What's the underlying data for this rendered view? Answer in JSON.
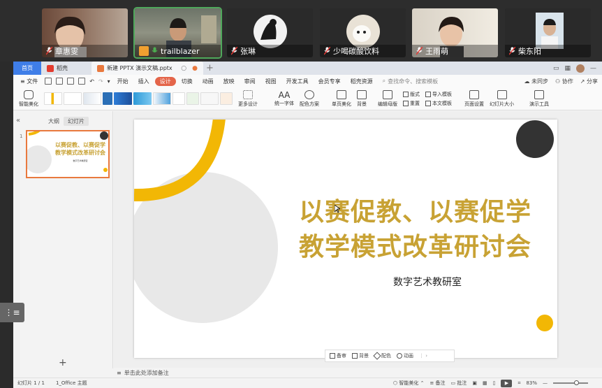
{
  "participants": [
    {
      "name": "章惠雯"
    },
    {
      "name": "trailblazer"
    },
    {
      "name": "张琳"
    },
    {
      "name": "少喝碳酸饮料"
    },
    {
      "name": "王雨萌"
    },
    {
      "name": "柴东阳"
    }
  ],
  "tabs": {
    "home": "首页",
    "wps": "稻壳",
    "file": "新建 PPTX 演示文稿.pptx"
  },
  "menu": {
    "file": "文件",
    "items": [
      "开始",
      "插入",
      "设计",
      "切换",
      "动画",
      "放映",
      "审阅",
      "视图",
      "开发工具",
      "会员专享",
      "稻壳资源"
    ],
    "active_index": 2,
    "search": "查找命令、搜索模板",
    "sync": "未同步",
    "collab": "协作",
    "share": "分享"
  },
  "ribbon": {
    "smart_beautify": "智能美化",
    "more_design": "更多设计",
    "unify_font": "统一字体",
    "color_scheme": "配色方案",
    "single_beautify": "单页美化",
    "background": "背景",
    "edit_master": "编辑母版",
    "format": "版式",
    "reset": "重置",
    "import_template": "导入模板",
    "text_template": "本文模板",
    "page_setup": "页面设置",
    "slide_size": "幻灯片大小",
    "presenter_tools": "演示工具"
  },
  "left_panel": {
    "outline_tab": "大纲",
    "slides_tab": "幻灯片",
    "slide_number": "1",
    "thumb_title": "以赛促教、以赛促学\n教学模式改革研讨会",
    "thumb_subtitle": "数字艺术教研室"
  },
  "slide": {
    "title_line1": "以赛促教、以赛促学",
    "title_line2": "教学模式改革研讨会",
    "subtitle": "数字艺术教研室",
    "colors": {
      "accent": "#f2b705",
      "gray": "#e8e8e8",
      "dark": "#333333",
      "title": "#c8a234"
    }
  },
  "floating_toolbar": {
    "doc": "备审",
    "background": "背景",
    "color": "配色",
    "animation": "动画"
  },
  "notes": "单击此处添加备注",
  "status": {
    "slide_pos": "幻灯片 1 / 1",
    "theme": "1_Office 主题",
    "smart_beautify": "智能美化",
    "notes": "备注",
    "comments": "批注",
    "zoom": "83%"
  }
}
